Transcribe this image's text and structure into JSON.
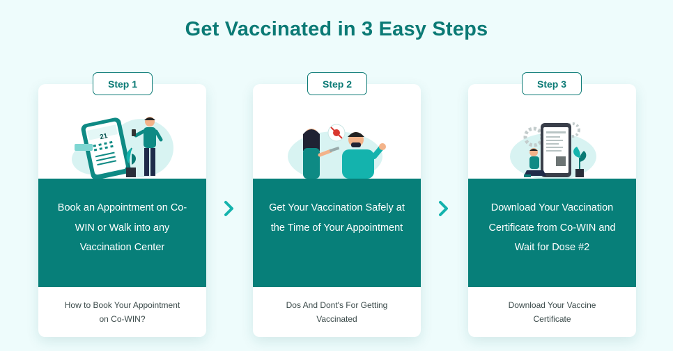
{
  "heading": "Get Vaccinated in 3 Easy Steps",
  "colors": {
    "primary": "#077f79",
    "accent": "#14b3ad",
    "background": "#eefcfc"
  },
  "steps": [
    {
      "badge": "Step 1",
      "description": "Book an Appointment on Co-WIN or Walk into any Vaccination Center",
      "link": "How to Book Your Appointment on Co-WIN?",
      "phone_date": "21",
      "illustration": "booking-illustration-icon"
    },
    {
      "badge": "Step 2",
      "description": "Get Your Vaccination Safely at the Time of Your Appointment",
      "link": "Dos And Dont's For Getting Vaccinated",
      "illustration": "vaccination-illustration-icon"
    },
    {
      "badge": "Step 3",
      "description": "Download Your Vaccination Certificate from Co-WIN and Wait for Dose #2",
      "link": "Download Your Vaccine Certificate",
      "illustration": "certificate-illustration-icon"
    }
  ],
  "arrows": [
    "chevron-right-icon",
    "chevron-right-icon"
  ]
}
